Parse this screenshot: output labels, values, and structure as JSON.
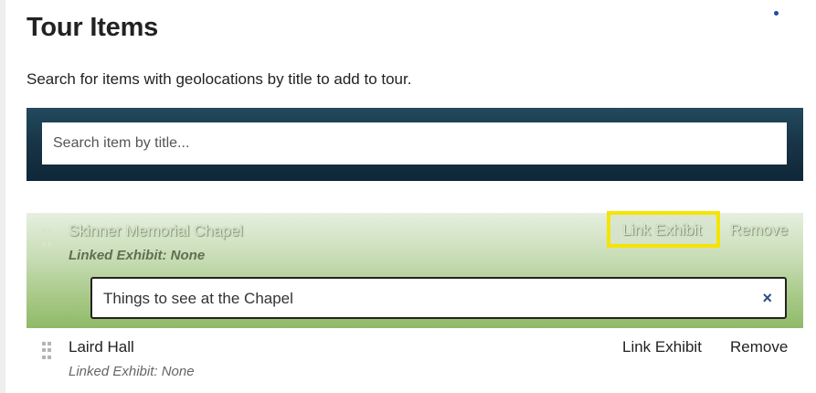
{
  "page": {
    "title": "Tour Items",
    "instructions": "Search for items with geolocations by title to add to tour."
  },
  "search": {
    "placeholder": "Search item by title..."
  },
  "items": [
    {
      "title": "Skinner Memorial Chapel",
      "linked_exhibit": "Linked Exhibit: None",
      "link_label": "Link Exhibit",
      "remove_label": "Remove",
      "exhibit_value": "Things to see at the Chapel",
      "clear_icon": "×",
      "active": true
    },
    {
      "title": "Laird Hall",
      "linked_exhibit": "Linked Exhibit: None",
      "link_label": "Link Exhibit",
      "remove_label": "Remove",
      "active": false
    }
  ],
  "colors": {
    "search_panel": "#173446",
    "active_row_green": "#8fba69",
    "highlight": "#f4e400",
    "clear_icon": "#2c4d86"
  }
}
